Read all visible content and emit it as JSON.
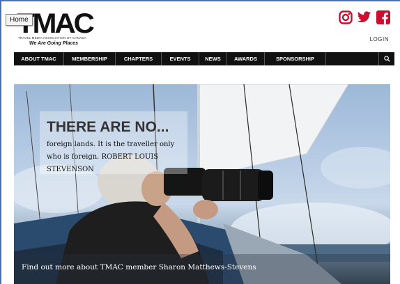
{
  "header": {
    "logo_main": "TMAC",
    "logo_subtitle": "TRAVEL MEDIA ASSOCIATION OF CANADA",
    "logo_tagline": "We Are Going Places",
    "tooltip": "Home",
    "login": "LOGIN",
    "social_icons": [
      "instagram-icon",
      "twitter-icon",
      "facebook-icon"
    ],
    "accent_color": "#c8102e"
  },
  "nav": {
    "items": [
      "ABOUT TMAC",
      "MEMBERSHIP",
      "CHAPTERS",
      "EVENTS",
      "NEWS",
      "AWARDS",
      "SPONSORSHIP"
    ],
    "search_icon": "search-icon"
  },
  "hero": {
    "quote_title": "THERE ARE NO...",
    "quote_text": "foreign lands. It is the traveller only who is foreign. ROBERT LOUIS STEVENSON",
    "caption": "Find out more about TMAC member Sharon Matthews-Stevens"
  }
}
